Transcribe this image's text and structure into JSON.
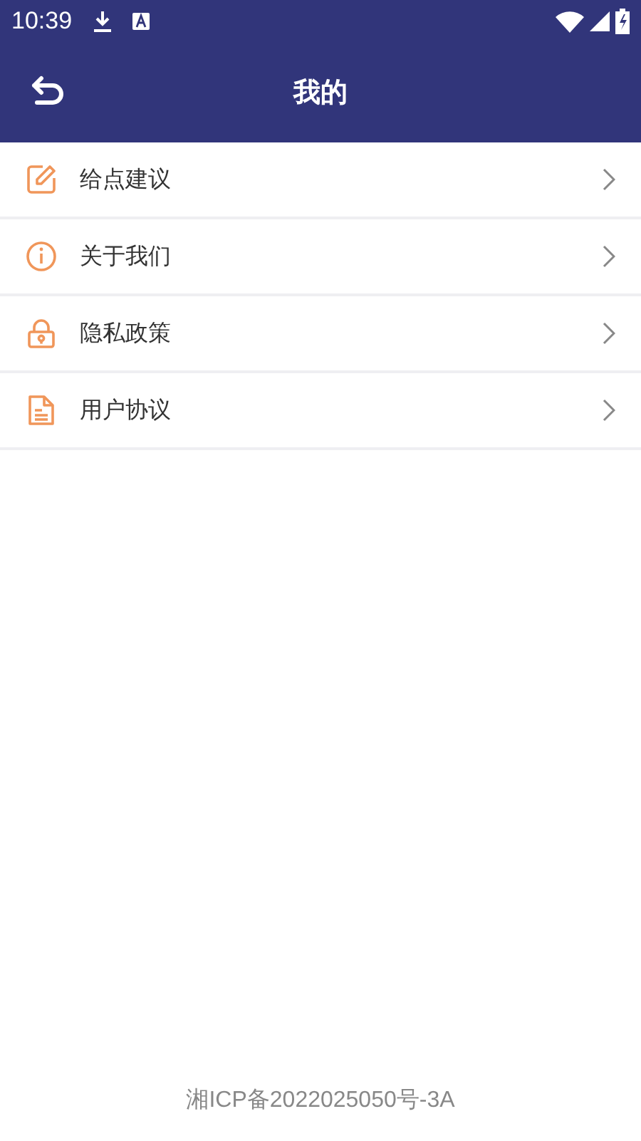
{
  "status_bar": {
    "time": "10:39"
  },
  "header": {
    "title": "我的"
  },
  "menu": [
    {
      "kind": "edit",
      "label": "给点建议"
    },
    {
      "kind": "info",
      "label": "关于我们"
    },
    {
      "kind": "lock",
      "label": "隐私政策"
    },
    {
      "kind": "document",
      "label": "用户协议"
    }
  ],
  "footer": {
    "text": "湘ICP备2022025050号-3A"
  }
}
